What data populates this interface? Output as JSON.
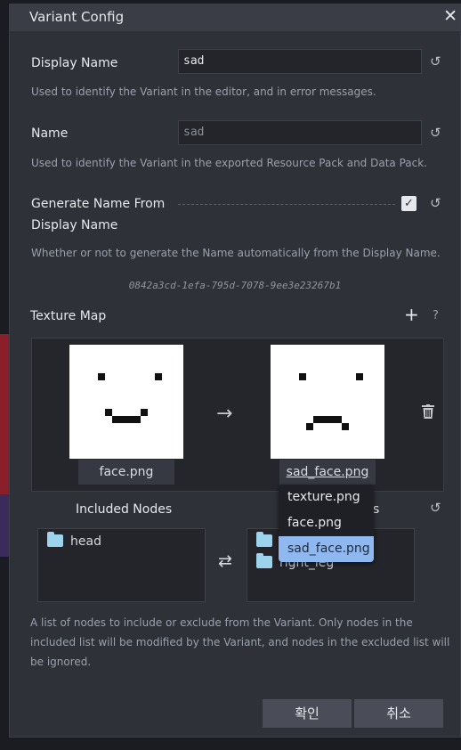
{
  "dialog": {
    "title": "Variant Config"
  },
  "display_name": {
    "label": "Display Name",
    "value": "sad",
    "desc": "Used to identify the Variant in the editor, and in error messages."
  },
  "name": {
    "label": "Name",
    "value": "sad",
    "desc": "Used to identify the Variant in the exported Resource Pack and Data Pack."
  },
  "generate_name": {
    "label_line1": "Generate Name From",
    "label_line2": "Display Name",
    "checked": true,
    "desc": "Whether or not to generate the Name automatically from the Display Name."
  },
  "uuid": "0842a3cd-1efa-795d-7078-9ee3e23267b1",
  "texture_map": {
    "label": "Texture Map",
    "add_icon": "plus-icon",
    "help_icon": "question-icon",
    "from_texture": "face.png",
    "to_texture": "sad_face.png",
    "arrow": "→",
    "dropdown_options": [
      "texture.png",
      "face.png",
      "sad_face.png"
    ],
    "dropdown_selected": "sad_face.png"
  },
  "nodes": {
    "included_title": "Included Nodes",
    "excluded_title_visible": "s",
    "included": [
      "head"
    ],
    "excluded": [
      "",
      "right_leg"
    ],
    "swap_icon": "⇄",
    "desc_line1": "A list of nodes to include or exclude from the Variant. Only nodes in the",
    "desc_line2": "included list will be modified by the Variant, and nodes in the excluded list will",
    "desc_line3": "be ignored."
  },
  "buttons": {
    "confirm": "확인",
    "cancel": "취소"
  },
  "colors": {
    "accent": "#8fb8f0",
    "folder": "#9cd4ee",
    "panel": "#2f3139"
  }
}
